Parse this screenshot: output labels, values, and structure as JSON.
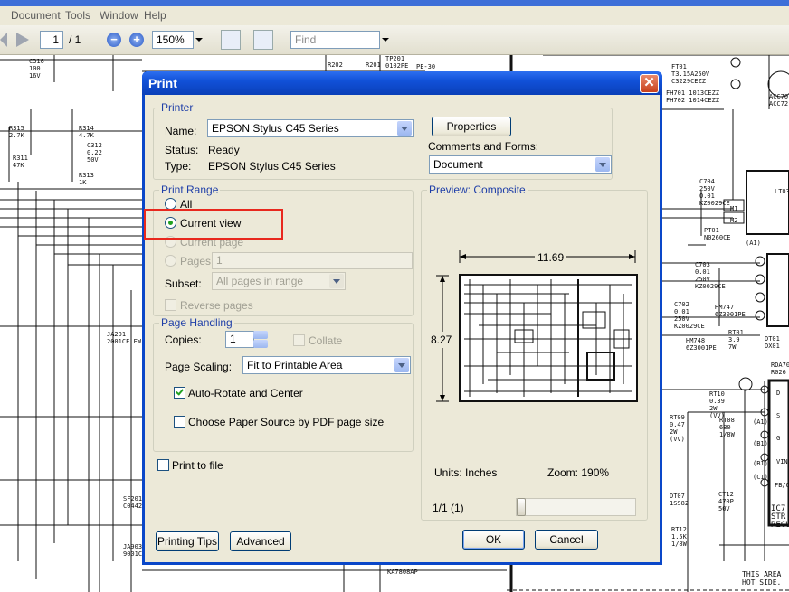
{
  "app": {
    "menu": [
      "Document",
      "Tools",
      "Window",
      "Help"
    ],
    "toolbar": {
      "page_current": "1",
      "page_separator": "/ 1",
      "zoom_zoom_out": "−",
      "zoom_zoom_in": "+",
      "zoom_value": "150%",
      "find_placeholder": "Find"
    },
    "schematic_labels": [
      "C316\n100\n16V",
      "R202",
      "R201",
      "TP201\n0102PE",
      "PE-30",
      "R315\n2.7K",
      "R314\n4.7K",
      "C312\n0.22\n50V",
      "R311\n47K",
      "R313\n1K",
      "JA201\n2001CE FW",
      "SF201\nC0442",
      "JA903\n9001C",
      "KA7808AP",
      "FT01\nT3.15A250V\nC3229CEZZ",
      "FH701 1013CEZZ\nFH702 1014CEZZ",
      "ACC70\nACC72",
      "C704\n250V\n0.01\nKZ0029CE",
      "LT03",
      "M1",
      "M2",
      "PT01\nN0260CE",
      "C703\n0.01\n250V\nKZ0029CE",
      "C702\n0.01\n250V\nKZ0029CE",
      "HM747\n6Z3001PE",
      "HM748\n6Z3001PE",
      "RT01\n3.9\n7W",
      "DT01\nDX01",
      "RDA70\nR026",
      "RT10\n0.39\n2W\n(VV)",
      "RT09\n0.47\n2W\n(VV)",
      "RT08\n680\n1/8W",
      "DT07\n1SS82",
      "CT12\n470P\n50V",
      "RT12\n1.5K\n1/8W",
      "IC7\nSTR\nREGU",
      "THIS AREA\nHOT SIDE.",
      "(A1)",
      "(A1)",
      "(B1)",
      "(B1)",
      "(C1)",
      "VIN",
      "FB/O",
      "D",
      "S",
      "G"
    ]
  },
  "dialog": {
    "title": "Print",
    "close_glyph": "✕",
    "printer": {
      "section": "Printer",
      "name_label": "Name:",
      "name_value": "EPSON Stylus C45 Series",
      "status_label": "Status:",
      "status_value": "Ready",
      "type_label": "Type:",
      "type_value": "EPSON Stylus C45 Series",
      "properties_button": "Properties",
      "comments_label": "Comments and Forms:",
      "comments_value": "Document"
    },
    "print_range": {
      "section": "Print Range",
      "all": "All",
      "current_view": "Current view",
      "current_page": "Current page",
      "pages": "Pages",
      "pages_value": "1",
      "subset_label": "Subset:",
      "subset_value": "All pages in range",
      "reverse_pages": "Reverse pages",
      "selected": "current_view"
    },
    "page_handling": {
      "section": "Page Handling",
      "copies_label": "Copies:",
      "copies_value": "1",
      "collate": "Collate",
      "scaling_label": "Page Scaling:",
      "scaling_value": "Fit to Printable Area",
      "auto_rotate": "Auto-Rotate and Center",
      "auto_rotate_checked": true,
      "paper_source": "Choose Paper Source by PDF page size",
      "paper_source_checked": false
    },
    "print_to_file": "Print to file",
    "preview": {
      "section": "Preview: Composite",
      "width": "11.69",
      "height": "8.27",
      "units": "Units: Inches",
      "zoom": "Zoom: 190%",
      "page_info": "1/1 (1)"
    },
    "buttons": {
      "printing_tips": "Printing Tips",
      "advanced": "Advanced",
      "ok": "OK",
      "cancel": "Cancel"
    }
  }
}
